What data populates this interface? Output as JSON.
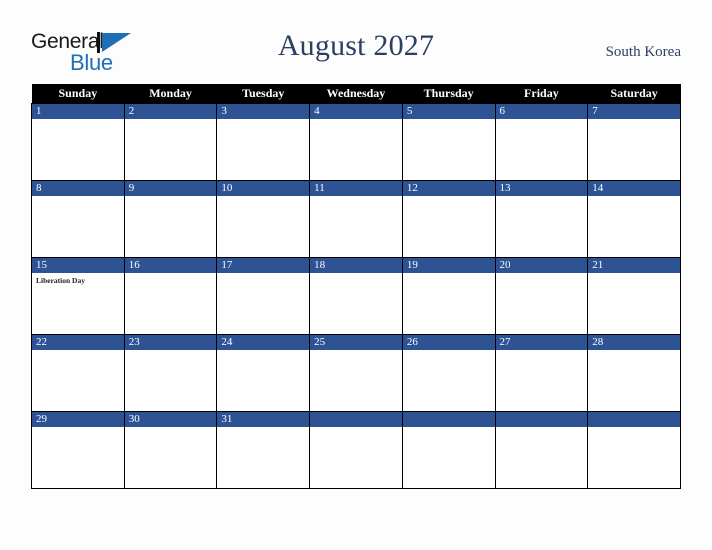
{
  "brand": {
    "name_part1": "General",
    "name_part2": "Blue",
    "colors": {
      "general_text": "#1a1a1a",
      "blue_text": "#1f6fb5",
      "mark_blue": "#1f6fb5"
    }
  },
  "header": {
    "title": "August 2027",
    "region": "South Korea"
  },
  "colors": {
    "header_row_bg": "#000000",
    "day_band_bg": "#2e5394",
    "grid_border": "#000000",
    "page_bg": "#fdfdfd",
    "title_text": "#2d3e63"
  },
  "weekday_headers": [
    "Sunday",
    "Monday",
    "Tuesday",
    "Wednesday",
    "Thursday",
    "Friday",
    "Saturday"
  ],
  "weeks": [
    [
      {
        "day": "1",
        "events": ""
      },
      {
        "day": "2",
        "events": ""
      },
      {
        "day": "3",
        "events": ""
      },
      {
        "day": "4",
        "events": ""
      },
      {
        "day": "5",
        "events": ""
      },
      {
        "day": "6",
        "events": ""
      },
      {
        "day": "7",
        "events": ""
      }
    ],
    [
      {
        "day": "8",
        "events": ""
      },
      {
        "day": "9",
        "events": ""
      },
      {
        "day": "10",
        "events": ""
      },
      {
        "day": "11",
        "events": ""
      },
      {
        "day": "12",
        "events": ""
      },
      {
        "day": "13",
        "events": ""
      },
      {
        "day": "14",
        "events": ""
      }
    ],
    [
      {
        "day": "15",
        "events": "Liberation Day"
      },
      {
        "day": "16",
        "events": ""
      },
      {
        "day": "17",
        "events": ""
      },
      {
        "day": "18",
        "events": ""
      },
      {
        "day": "19",
        "events": ""
      },
      {
        "day": "20",
        "events": ""
      },
      {
        "day": "21",
        "events": ""
      }
    ],
    [
      {
        "day": "22",
        "events": ""
      },
      {
        "day": "23",
        "events": ""
      },
      {
        "day": "24",
        "events": ""
      },
      {
        "day": "25",
        "events": ""
      },
      {
        "day": "26",
        "events": ""
      },
      {
        "day": "27",
        "events": ""
      },
      {
        "day": "28",
        "events": ""
      }
    ],
    [
      {
        "day": "29",
        "events": ""
      },
      {
        "day": "30",
        "events": ""
      },
      {
        "day": "31",
        "events": ""
      },
      {
        "day": "",
        "events": ""
      },
      {
        "day": "",
        "events": ""
      },
      {
        "day": "",
        "events": ""
      },
      {
        "day": "",
        "events": ""
      }
    ]
  ]
}
